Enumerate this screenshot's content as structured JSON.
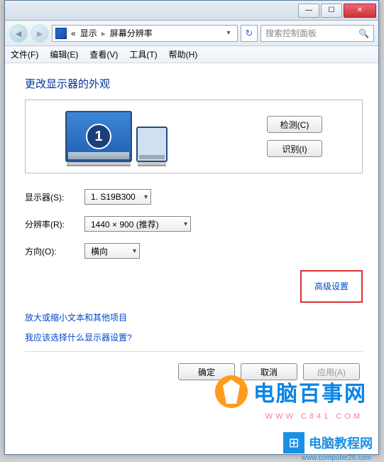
{
  "titlebar": {
    "min": "—",
    "max": "☐",
    "close": "✕"
  },
  "nav": {
    "back": "◄",
    "fwd": "►",
    "crumb_prefix": "«",
    "crumb1": "显示",
    "crumb_sep": "▸",
    "crumb2": "屏幕分辨率",
    "dropdown": "▾",
    "refresh": "↻",
    "search_placeholder": "搜索控制面板",
    "search_icon": "🔍"
  },
  "menu": {
    "file": "文件(F)",
    "edit": "编辑(E)",
    "view": "查看(V)",
    "tools": "工具(T)",
    "help": "帮助(H)"
  },
  "heading": "更改显示器的外观",
  "preview": {
    "monitor_number": "1",
    "detect": "检测(C)",
    "identify": "识别(I)"
  },
  "form": {
    "display_label": "显示器(S):",
    "display_value": "1. S19B300",
    "resolution_label": "分辨率(R):",
    "resolution_value": "1440 × 900 (推荐)",
    "orientation_label": "方向(O):",
    "orientation_value": "横向",
    "arrow": "▾"
  },
  "advanced": "高级设置",
  "links": {
    "text_size": "放大或缩小文本和其他项目",
    "which_settings": "我应该选择什么显示器设置?"
  },
  "buttons": {
    "ok": "确定",
    "cancel": "取消",
    "apply": "应用(A)"
  },
  "watermark1": {
    "text": "电脑百事网",
    "sub": "WWW  C841 COM"
  },
  "watermark2": {
    "text": "电脑教程网",
    "icon": "⊞",
    "sub": "www.computer26.com"
  }
}
